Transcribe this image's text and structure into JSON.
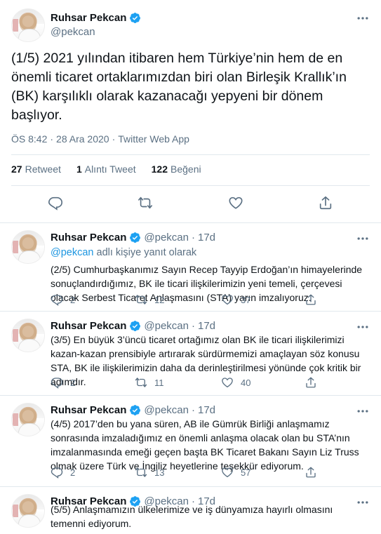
{
  "main": {
    "name": "Ruhsar Pekcan",
    "handle": "@pekcan",
    "text": "(1/5) 2021 yılından itibaren hem Türkiye’nin hem de en önemli ticaret ortaklarımızdan biri olan Birleşik Krallık’ın (BK) karşılıklı olarak kazanacağı yepyeni bir dönem başlıyor.",
    "time": "ÖS 8:42",
    "sep": "·",
    "date": "28 Ara 2020",
    "source": "Twitter Web App",
    "stats": {
      "retweets": "27",
      "retweets_label": "Retweet",
      "quotes": "1",
      "quotes_label": "Alıntı Tweet",
      "likes": "122",
      "likes_label": "Beğeni"
    }
  },
  "replies": [
    {
      "name": "Ruhsar Pekcan",
      "handle": "@pekcan",
      "dot": "·",
      "time": "17d",
      "reply_to_mention": "@pekcan",
      "reply_to_text": " adlı kişiye yanıt olarak",
      "text": "(2/5) Cumhurbaşkanımız Sayın Recep Tayyip Erdoğan’ın himayelerinde sonuçlandırdığımız, BK ile ticari ilişkilerimizin yeni temeli, çerçevesi olacak Serbest Ticaret Anlaşmasını (STA) yarın imzalıyoruz.",
      "replies": "2",
      "retweets": "12",
      "likes": "37"
    },
    {
      "name": "Ruhsar Pekcan",
      "handle": "@pekcan",
      "dot": "·",
      "time": "17d",
      "text": "(3/5) En büyük 3’üncü ticaret ortağımız olan BK ile ticari ilişkilerimizi kazan-kazan prensibiyle artırarak sürdürmemizi amaçlayan söz konusu STA, BK ile ilişkilerimizin daha da derinleştirilmesi yönünde çok kritik bir adımdır.",
      "replies": "2",
      "retweets": "11",
      "likes": "40"
    },
    {
      "name": "Ruhsar Pekcan",
      "handle": "@pekcan",
      "dot": "·",
      "time": "17d",
      "text": "(4/5) 2017’den bu yana süren, AB ile Gümrük Birliği anlaşmamız sonrasında imzaladığımız en önemli anlaşma olacak olan bu STA’nın imzalanmasında emeği geçen başta BK Ticaret Bakanı Sayın Liz Truss olmak üzere Türk ve İngiliz heyetlerine teşekkür ediyorum.",
      "replies": "2",
      "retweets": "13",
      "likes": "57"
    },
    {
      "name": "Ruhsar Pekcan",
      "handle": "@pekcan",
      "dot": "·",
      "time": "17d",
      "text": "(5/5) Anlaşmamızın ülkelerimize ve iş dünyamıza hayırlı olmasını temenni ediyorum."
    }
  ],
  "icons": {
    "verified_color": "#1da1f2",
    "icon_color": "#5b7083",
    "names": [
      "verified-badge-icon",
      "more-icon",
      "reply-icon",
      "retweet-icon",
      "like-icon",
      "share-icon"
    ]
  }
}
